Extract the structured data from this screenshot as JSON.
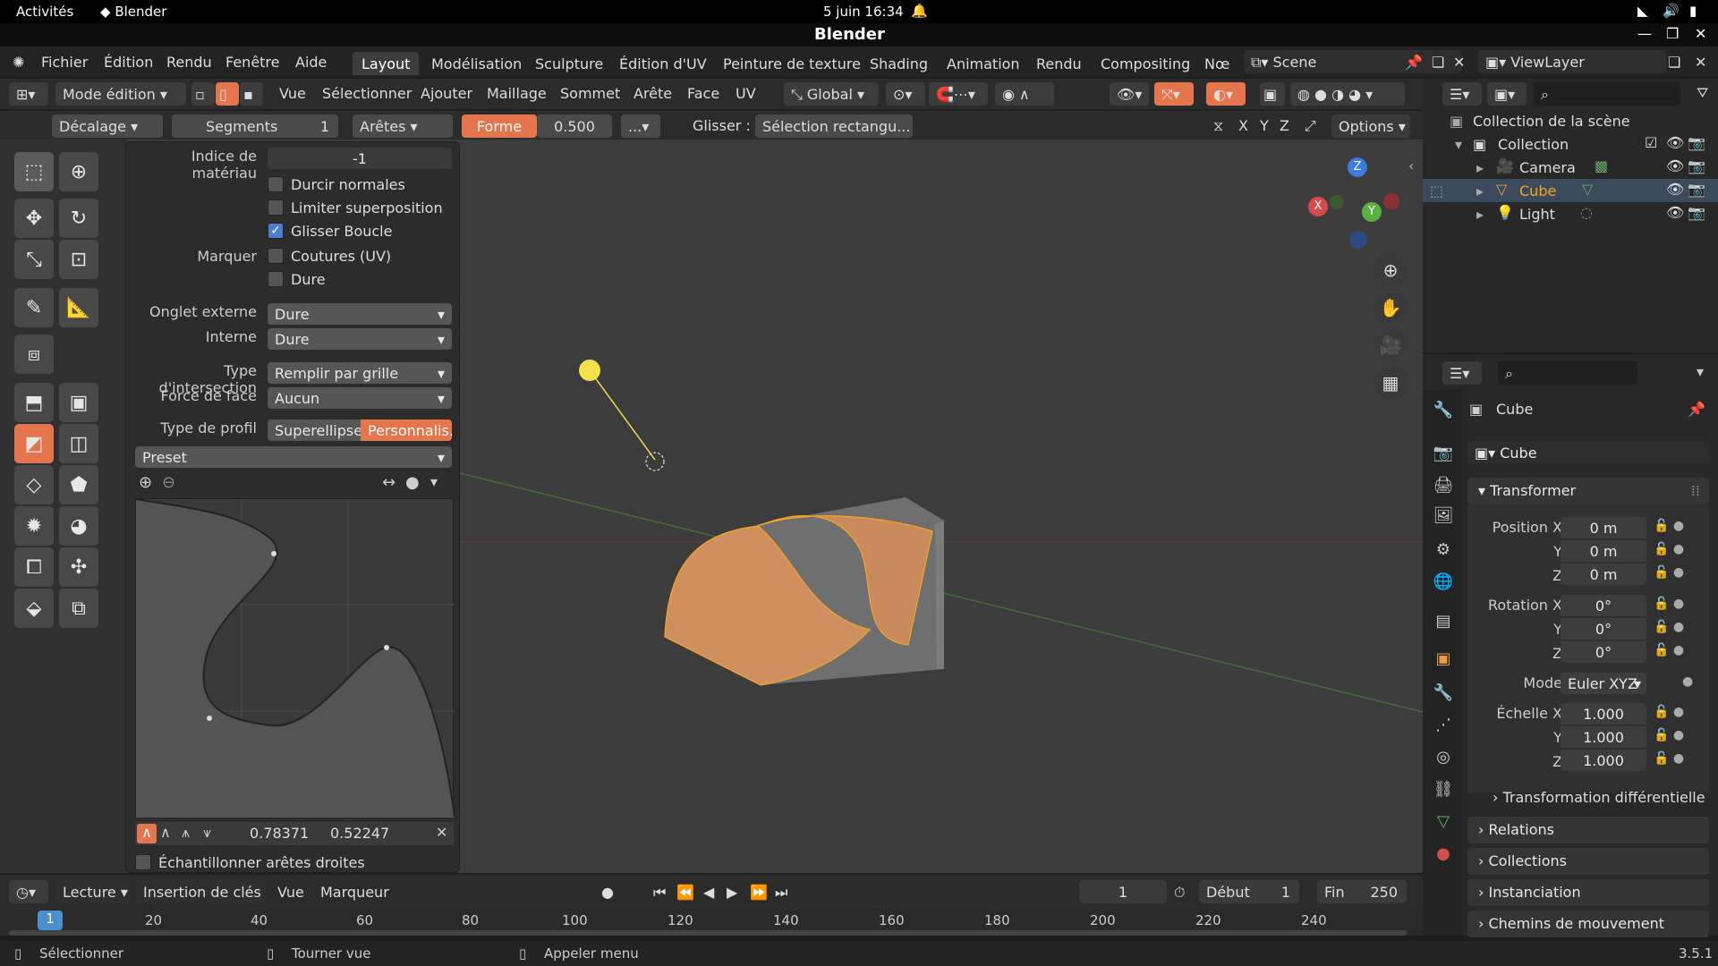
{
  "system": {
    "activities": "Activités",
    "app": "Blender",
    "clock": "5 juin  16:34"
  },
  "window": {
    "title": "Blender"
  },
  "menu": [
    "Fichier",
    "Édition",
    "Rendu",
    "Fenêtre",
    "Aide"
  ],
  "tabs": [
    "Layout",
    "Modélisation",
    "Sculpture",
    "Édition d'UV",
    "Peinture de texture",
    "Shading",
    "Animation",
    "Rendu",
    "Compositing",
    "Nœ"
  ],
  "scene": {
    "name": "Scene",
    "viewlayer": "ViewLayer"
  },
  "header": {
    "mode": "Mode édition",
    "items": [
      "Vue",
      "Sélectionner",
      "Ajouter",
      "Maillage",
      "Sommet",
      "Arête",
      "Face",
      "UV"
    ],
    "orientation": "Global"
  },
  "opbar": {
    "type": "Décalage",
    "segments_label": "Segments",
    "segments_value": "1",
    "affect": "Arêtes",
    "shape_label": "Forme",
    "shape_value": "0.500",
    "more": "...",
    "slide_label": "Glisser :",
    "slide_value": "Sélection rectangu...",
    "options": "Options",
    "axes": [
      "X",
      "Y",
      "Z"
    ]
  },
  "panel": {
    "material_label": "Indice de matériau",
    "material_value": "-1",
    "harden": "Durcir normales",
    "clamp": "Limiter superposition",
    "loop_slide": "Glisser Boucle",
    "mark_label": "Marquer",
    "seams": "Coutures (UV)",
    "sharp": "Dure",
    "miter_outer_label": "Onglet externe",
    "miter_outer": "Dure",
    "miter_inner_label": "Interne",
    "miter_inner": "Dure",
    "intersection_label": "Type d'intersection",
    "intersection": "Remplir par grille",
    "face_strength_label": "Force de face",
    "face_strength": "Aucun",
    "profile_label": "Type de profil",
    "profile_a": "Superellipse",
    "profile_b": "Personnalis...",
    "preset": "Preset",
    "point_x": "0.78371",
    "point_y": "0.52247",
    "sample": "Échantillonner arêtes droites"
  },
  "outliner": {
    "root": "Collection de la scène",
    "collection": "Collection",
    "items": [
      "Camera",
      "Cube",
      "Light"
    ]
  },
  "properties": {
    "object": "Cube",
    "data": "Cube",
    "transform": "Transformer",
    "pos_label": "Position X",
    "rot_label": "Rotation X",
    "scale_label": "Échelle X",
    "pos": [
      "0 m",
      "0 m",
      "0 m"
    ],
    "rot": [
      "0°",
      "0°",
      "0°"
    ],
    "mode_label": "Mode",
    "mode": "Euler XYZ",
    "scale": [
      "1.000",
      "1.000",
      "1.000"
    ],
    "delta": "Transformation différentielle",
    "sections": [
      "Relations",
      "Collections",
      "Instanciation",
      "Chemins de mouvement"
    ]
  },
  "timeline": {
    "playback": "Lecture",
    "keying": "Insertion de clés",
    "view": "Vue",
    "marker": "Marqueur",
    "frame": "1",
    "start_label": "Début",
    "start": "1",
    "end_label": "Fin",
    "end": "250",
    "ticks": [
      "1",
      "20",
      "40",
      "60",
      "80",
      "100",
      "120",
      "140",
      "160",
      "180",
      "200",
      "220",
      "240"
    ]
  },
  "status": {
    "select": "Sélectionner",
    "rotate": "Tourner vue",
    "menu": "Appeler menu",
    "version": "3.5.1"
  },
  "colors": {
    "accent": "#e4754c",
    "selected": "#f5a623"
  }
}
